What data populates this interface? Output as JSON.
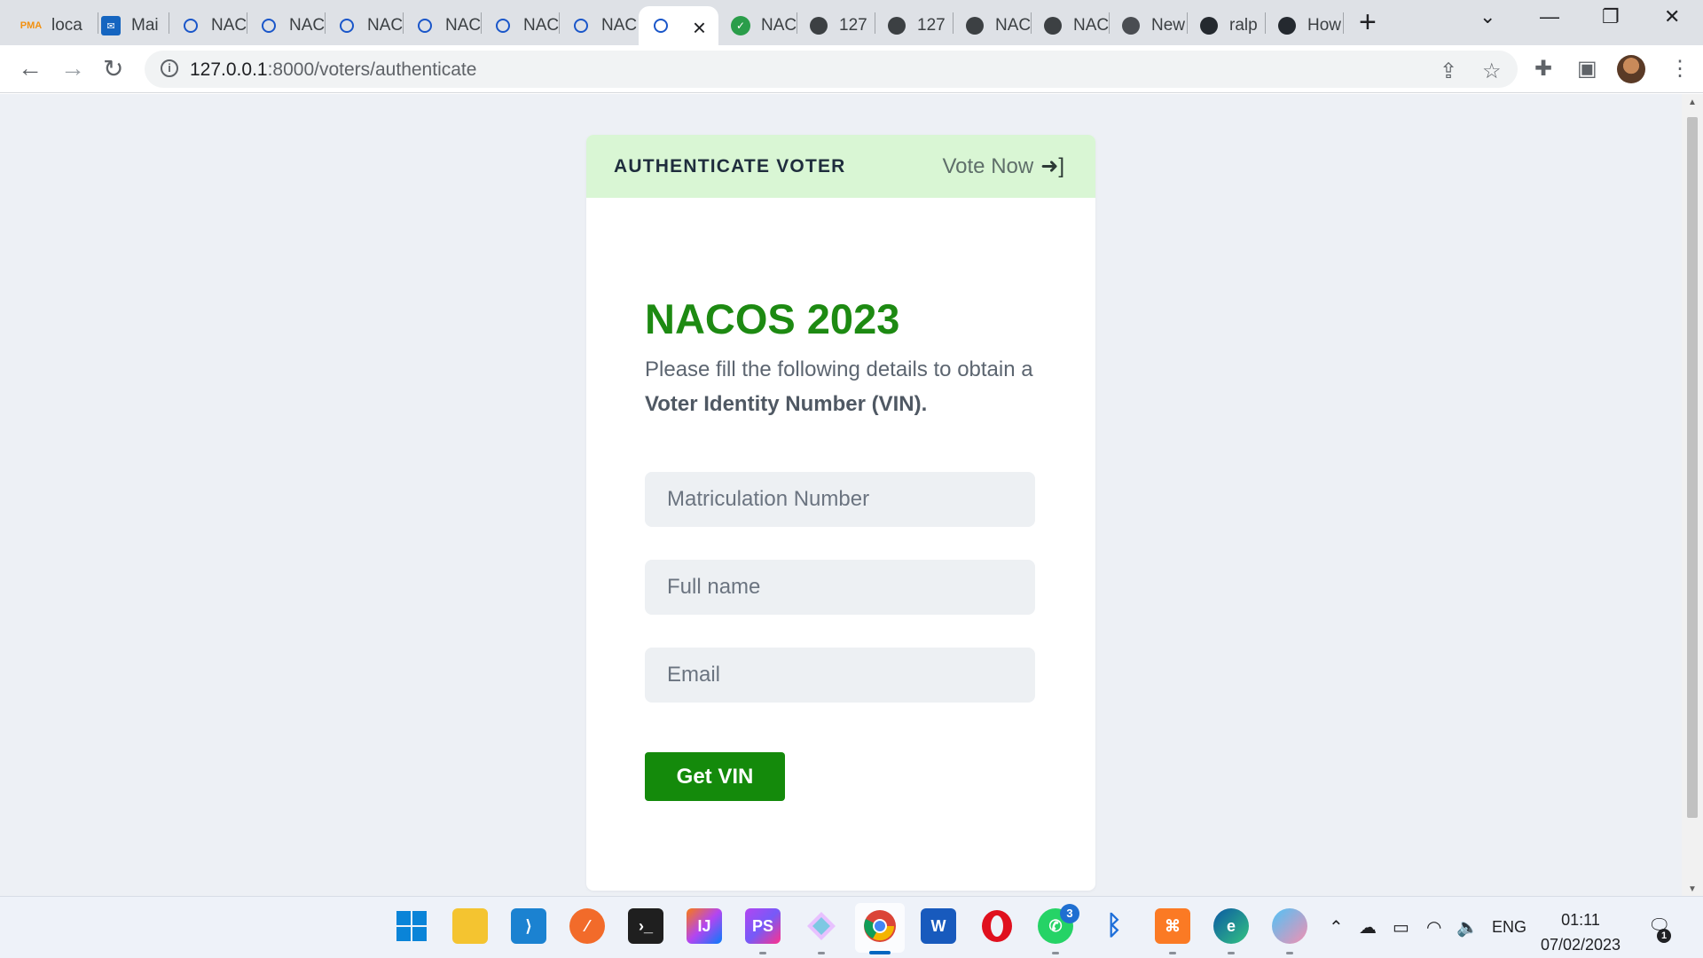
{
  "browser": {
    "tabs": [
      {
        "label": "loca",
        "icon": "phpmyadmin-icon"
      },
      {
        "label": "Mai",
        "icon": "mail-icon"
      },
      {
        "label": "NAC",
        "icon": "loading-ring-icon"
      },
      {
        "label": "NAC",
        "icon": "loading-ring-icon"
      },
      {
        "label": "NAC",
        "icon": "loading-ring-icon"
      },
      {
        "label": "NAC",
        "icon": "loading-ring-icon"
      },
      {
        "label": "NAC",
        "icon": "loading-ring-icon"
      },
      {
        "label": "NAC",
        "icon": "loading-ring-icon"
      },
      {
        "label": "",
        "icon": "loading-ring-icon",
        "active": true
      },
      {
        "label": "NAC",
        "icon": "shield-check-icon"
      },
      {
        "label": "127",
        "icon": "globe-icon"
      },
      {
        "label": "127",
        "icon": "globe-icon"
      },
      {
        "label": "NAC",
        "icon": "globe-icon"
      },
      {
        "label": "NAC",
        "icon": "globe-icon"
      },
      {
        "label": "New",
        "icon": "chrome-icon"
      },
      {
        "label": "ralp",
        "icon": "github-icon"
      },
      {
        "label": "How",
        "icon": "github-icon"
      }
    ],
    "new_tab_symbol": "+",
    "url_host": "127.0.0.1",
    "url_path": ":8000/voters/authenticate"
  },
  "page": {
    "header_title": "AUTHENTICATE VOTER",
    "vote_now_label": "Vote Now",
    "election_title": "NACOS 2023",
    "instructions_prefix": "Please fill the following details to obtain a",
    "instructions_bold": "Voter Identity Number (VIN).",
    "fields": {
      "matric_placeholder": "Matriculation Number",
      "fullname_placeholder": "Full name",
      "email_placeholder": "Email"
    },
    "submit_label": "Get VIN"
  },
  "taskbar": {
    "whatsapp_badge": "3",
    "language": "ENG",
    "time": "01:11",
    "date": "07/02/2023",
    "notification_count": "1"
  },
  "colors": {
    "header_bg": "#d9f6d4",
    "title_green": "#1d8a12",
    "button_green": "#148a0b",
    "page_bg": "#edf0f5"
  }
}
